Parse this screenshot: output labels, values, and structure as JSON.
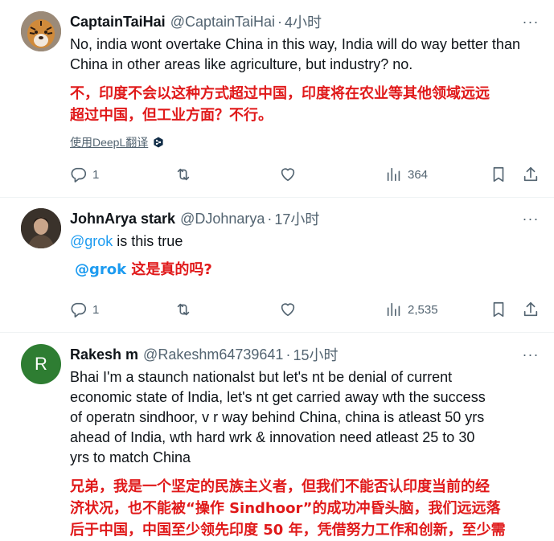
{
  "tweets": [
    {
      "name": "CaptainTaiHai",
      "handle": "@CaptainTaiHai",
      "dot": "·",
      "time": "4小时",
      "text_en": "No, india wont overtake China in this way, India will do way better than China in other areas like agriculture, but industry? no.",
      "text_zh_line1": "不，印度不会以这种方式超过中国，印度将在农业等其他领域远远",
      "text_zh_line2": "超过中国，但工业方面？不行。",
      "translate_label": "使用DeepL翻译",
      "replies": "1",
      "views": "364",
      "avatar_icon": "tiger-avatar"
    },
    {
      "name": "JohnArya stark",
      "handle": "@DJohnarya",
      "dot": "·",
      "time": "17小时",
      "mention_en": "@grok",
      "text_en": " is this true",
      "mention_zh": "@grok",
      "text_zh": " 这是真的吗?",
      "replies": "1",
      "views": "2,535",
      "avatar_icon": "person-avatar"
    },
    {
      "name": "Rakesh m",
      "handle": "@Rakeshm64739641",
      "dot": "·",
      "time": "15小时",
      "avatar_letter": "R",
      "avatar_color": "#2e7d32",
      "text_en_lines": [
        "Bhai I'm a staunch nationalst but let's nt be denial of current",
        "economic state of India, let's nt get carried away wth the success",
        "of operatn sindhoor, v r way behind China, china is atleast 50 yrs",
        "ahead of India, wth hard wrk & innovation need atleast 25 to 30",
        "yrs to match China"
      ],
      "text_zh_lines": [
        "兄弟，我是一个坚定的民族主义者，但我们不能否认印度当前的经",
        "济状况，也不能被“操作 Sindhoor”的成功冲昏头脑，我们远远落",
        "后于中国，中国至少领先印度 50 年，凭借努力工作和创新，至少需"
      ]
    }
  ],
  "more_label": "···",
  "colors": {
    "link": "#1d9bf0",
    "translation": "#e0191a",
    "secondary": "#536471"
  }
}
